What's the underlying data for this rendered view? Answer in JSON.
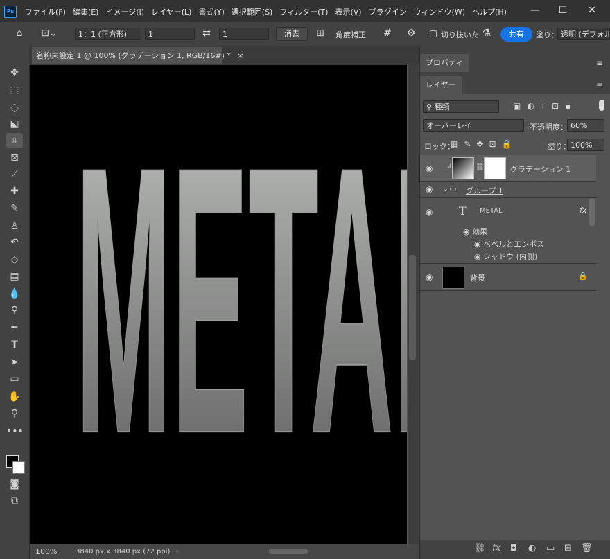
{
  "app": {
    "logo_text": "Ps"
  },
  "menubar": {
    "items": [
      "ファイル(F)",
      "編集(E)",
      "イメージ(I)",
      "レイヤー(L)",
      "書式(Y)",
      "選択範囲(S)",
      "フィルター(T)",
      "表示(V)",
      "プラグイン",
      "ウィンドウ(W)",
      "ヘルプ(H)"
    ],
    "window_controls": {
      "minimize": "—",
      "maximize": "☐",
      "close": "✕"
    }
  },
  "options": {
    "ratio_select": "1：1 (正方形)",
    "width_value": "1",
    "height_value": "1",
    "clear_label": "消去",
    "straighten_label": "角度補正",
    "delete_cropped_label": "切り抜いたピ",
    "share_label": "共有",
    "fill_label": "塗り：",
    "fill_value": "透明 (デフォル"
  },
  "document": {
    "tab_title": "名称未設定 1 @ 100% (グラデーション 1, RGB/16#) *",
    "tab_close": "×",
    "canvas_text": "METAL",
    "zoom": "100%",
    "doc_info": "3840 px x 3840 px (72 ppi)",
    "status_arrow": "›"
  },
  "panels": {
    "properties_tab": "プロパティ",
    "layers_tab": "レイヤー",
    "filter_kind": "種類",
    "blend_mode": "オーバーレイ",
    "opacity_label": "不透明度：",
    "opacity_value": "60%",
    "lock_label": "ロック：",
    "fill_label": "塗り：",
    "fill_value": "100%"
  },
  "layers": [
    {
      "name": "グラデーション 1",
      "type": "gradient-fill",
      "selected": true
    },
    {
      "name": "グループ 1",
      "type": "group"
    },
    {
      "name": "METAL",
      "type": "text",
      "fx": "fx"
    },
    {
      "name": "効果",
      "type": "effects"
    },
    {
      "name": "ベベルとエンボス",
      "type": "effect"
    },
    {
      "name": "シャドウ (内側)",
      "type": "effect"
    },
    {
      "name": "背景",
      "type": "background"
    }
  ],
  "colors": {
    "accent": "#1473e6",
    "panel": "#424242",
    "canvas": "#000000"
  }
}
